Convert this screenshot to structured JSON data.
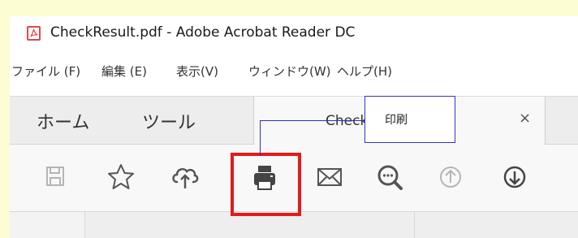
{
  "window": {
    "title": "CheckResult.pdf - Adobe Acrobat Reader DC"
  },
  "menu": {
    "items": [
      "ファイル (F)",
      "編集 (E)",
      "表示(V)",
      "ウィンドウ(W)",
      "ヘルプ(H)"
    ]
  },
  "tabs": {
    "home": "ホーム",
    "tools": "ツール",
    "document": "CheckResult.pdf",
    "close": "×"
  },
  "toolbar": {
    "icons": [
      "save-icon",
      "star-icon",
      "cloud-upload-icon",
      "printer-icon",
      "mail-icon",
      "zoom-search-icon",
      "page-up-icon",
      "page-down-icon"
    ],
    "highlighted": "printer-icon"
  },
  "callout": {
    "label": "印刷"
  },
  "colors": {
    "page_background": "#fdfdd3",
    "highlight_border": "#e21b1b",
    "callout_line": "#2d2dd6",
    "acrobat_red": "#d94a4a"
  }
}
